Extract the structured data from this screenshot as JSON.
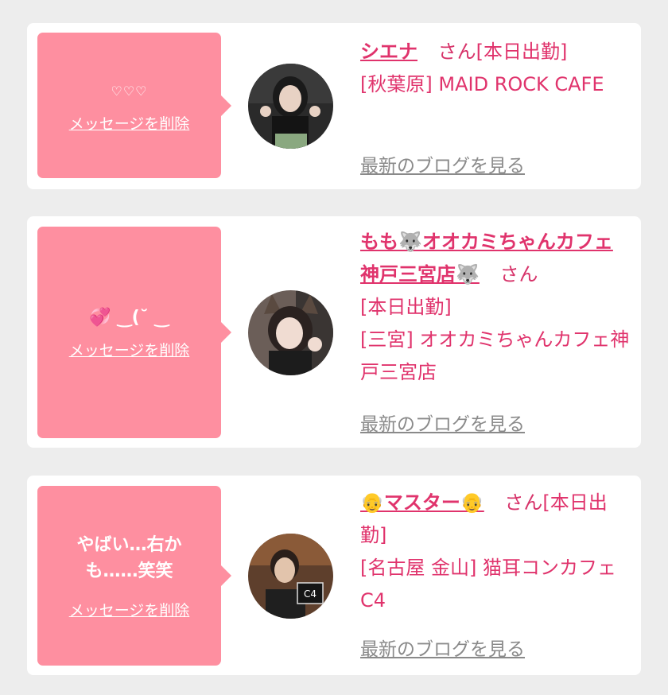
{
  "cards": [
    {
      "message": "♡♡♡",
      "delete_label": "メッセージを削除",
      "name": "シエナ",
      "honorific": "さん",
      "status": "[本日出勤]",
      "shop_area": "[秋葉原]",
      "shop_name": "MAID ROCK CAFE",
      "blog_label": "最新のブログを見る"
    },
    {
      "message": "💞 ‿(˘ ‿",
      "delete_label": "メッセージを削除",
      "name": "もも🐺オオカミちゃんカフェ神戸三宮店🐺",
      "honorific": "さん",
      "status": "[本日出勤]",
      "shop_area": "[三宮]",
      "shop_name": "オオカミちゃんカフェ神戸三宮店",
      "blog_label": "最新のブログを見る"
    },
    {
      "message": "やばい…右かも……笑笑",
      "delete_label": "メッセージを削除",
      "name": "👴マスター👴",
      "honorific": "さん",
      "status": "[本日出勤]",
      "shop_area": "[名古屋 金山]",
      "shop_name": "猫耳コンカフェ C4",
      "blog_label": "最新のブログを見る"
    }
  ],
  "colors": {
    "page_bg": "#ededed",
    "bubble": "#fe8fa0",
    "accent": "#e0336c",
    "muted_link": "#8a8a8a"
  }
}
